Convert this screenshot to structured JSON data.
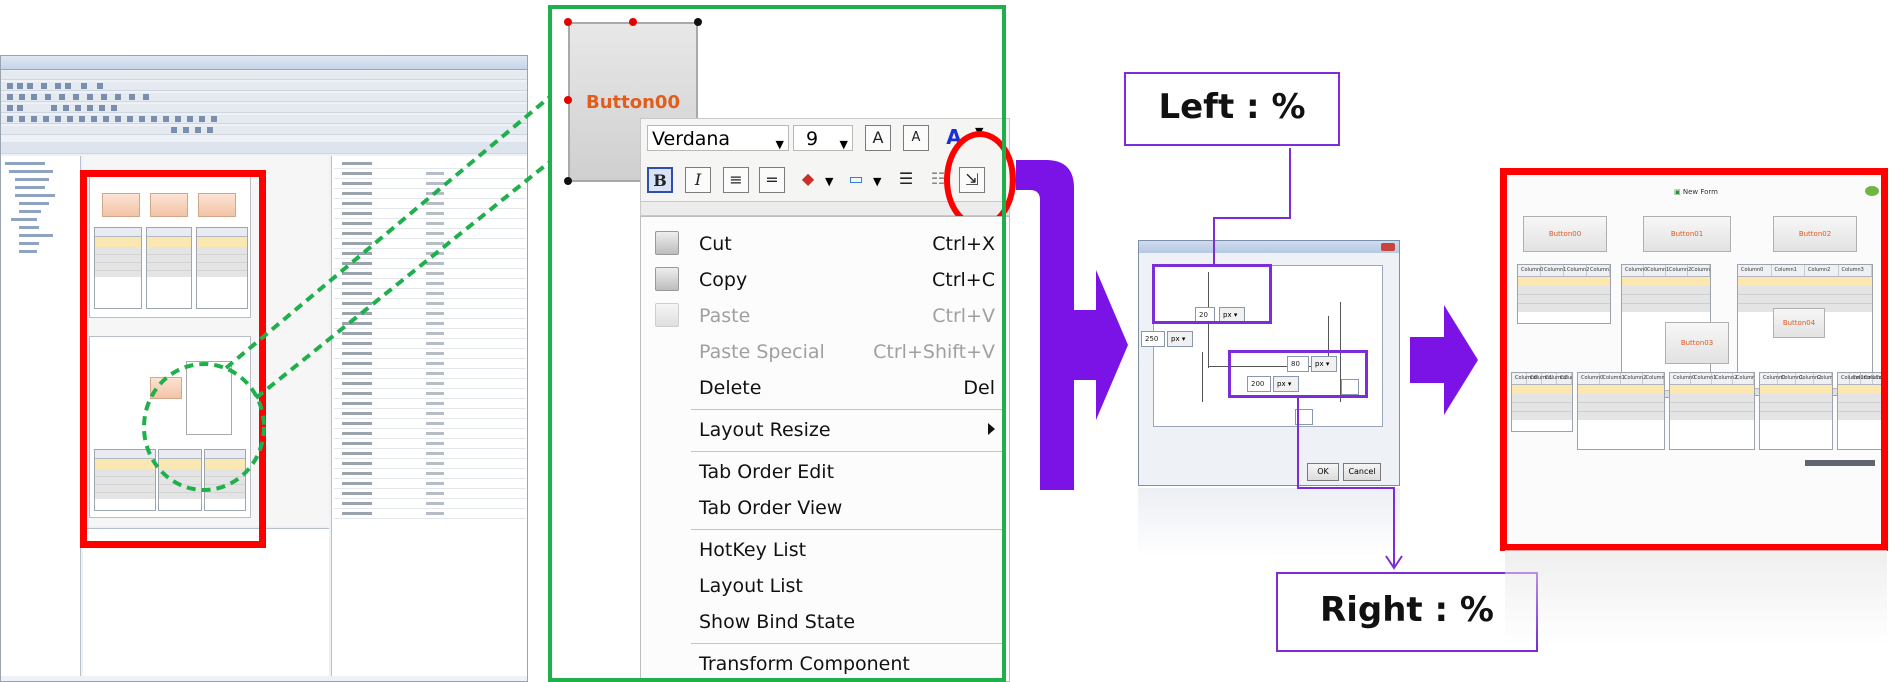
{
  "context_menu": {
    "font_family": "Verdana",
    "font_size": "9",
    "button_caption": "Button00",
    "items": [
      {
        "label": "Cut",
        "shortcut": "Ctrl+X",
        "enabled": true,
        "icon": "scissors-icon"
      },
      {
        "label": "Copy",
        "shortcut": "Ctrl+C",
        "enabled": true,
        "icon": "copy-icon"
      },
      {
        "label": "Paste",
        "shortcut": "Ctrl+V",
        "enabled": false,
        "icon": "paste-icon"
      },
      {
        "label": "Paste Special",
        "shortcut": "Ctrl+Shift+V",
        "enabled": false
      },
      {
        "label": "Delete",
        "shortcut": "Del",
        "enabled": true
      },
      {
        "label": "Layout Resize",
        "shortcut": "",
        "enabled": true,
        "submenu": true
      },
      {
        "label": "Tab Order Edit",
        "shortcut": "",
        "enabled": true
      },
      {
        "label": "Tab Order View",
        "shortcut": "",
        "enabled": true
      },
      {
        "label": "HotKey List",
        "shortcut": "",
        "enabled": true
      },
      {
        "label": "Layout List",
        "shortcut": "",
        "enabled": true
      },
      {
        "label": "Show Bind State",
        "shortcut": "",
        "enabled": true
      },
      {
        "label": "Transform Component",
        "shortcut": "",
        "enabled": true
      }
    ]
  },
  "callouts": {
    "left": "Left : %",
    "right": "Right : %"
  },
  "dialog": {
    "left_value": "20",
    "left_unit": "px",
    "top_value": "250",
    "top_unit": "px",
    "right_value": "80",
    "right_unit": "px",
    "bottom_value": "200",
    "bottom_unit": "px",
    "ok": "OK",
    "cancel": "Cancel"
  },
  "result_form": {
    "title": "New Form",
    "buttons": [
      "Button00",
      "Button01",
      "Button02",
      "Button03",
      "Button04"
    ],
    "column_headers": [
      "Column0",
      "Column1",
      "Column2",
      "Column3"
    ]
  },
  "colors": {
    "highlight_red": "#ff0000",
    "zoom_green": "#1fb04c",
    "arrow_purple": "#7b12e6",
    "callout_border": "#7c2cd8",
    "button_text": "#e25c1c"
  }
}
